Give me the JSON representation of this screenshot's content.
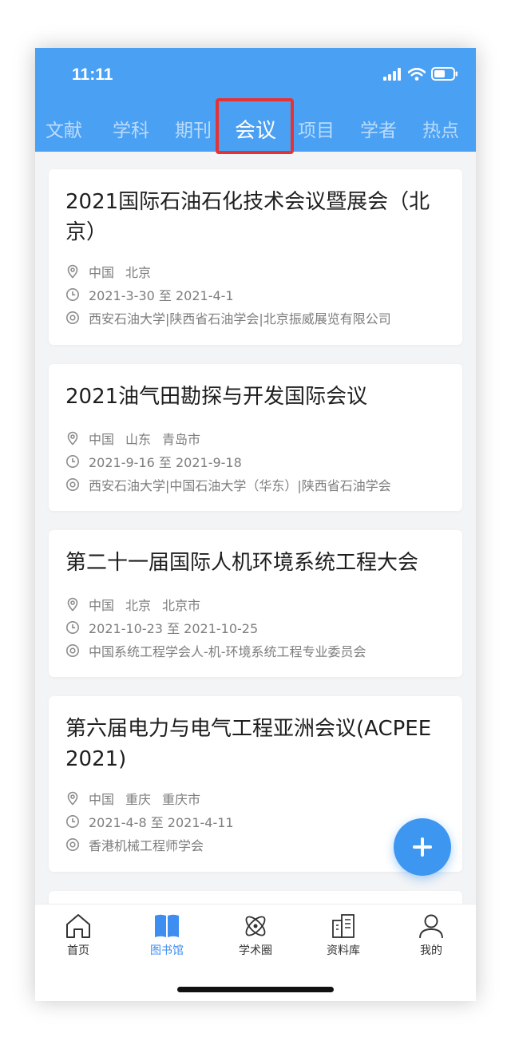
{
  "status_bar": {
    "time": "11:11"
  },
  "category_tabs": [
    {
      "label": "文献",
      "active": false
    },
    {
      "label": "学科",
      "active": false
    },
    {
      "label": "期刊",
      "active": false
    },
    {
      "label": "会议",
      "active": true
    },
    {
      "label": "项目",
      "active": false
    },
    {
      "label": "学者",
      "active": false
    },
    {
      "label": "热点",
      "active": false
    }
  ],
  "conferences": [
    {
      "title": "2021国际石油石化技术会议暨展会（北京）",
      "location": [
        "中国",
        "北京"
      ],
      "dates": "2021-3-30 至 2021-4-1",
      "organizers": "西安石油大学|陕西省石油学会|北京振威展览有限公司"
    },
    {
      "title": "2021油气田勘探与开发国际会议",
      "location": [
        "中国",
        "山东",
        "青岛市"
      ],
      "dates": "2021-9-16 至 2021-9-18",
      "organizers": "西安石油大学|中国石油大学（华东）|陕西省石油学会"
    },
    {
      "title": "第二十一届国际人机环境系统工程大会",
      "location": [
        "中国",
        "北京",
        "北京市"
      ],
      "dates": "2021-10-23 至 2021-10-25",
      "organizers": "中国系统工程学会人-机-环境系统工程专业委员会"
    },
    {
      "title": "第六届电力与电气工程亚洲会议(ACPEE 2021)",
      "location": [
        "中国",
        "重庆",
        "重庆市"
      ],
      "dates": "2021-4-8 至 2021-4-11",
      "organizers": "香港机械工程师学会"
    }
  ],
  "bottom_nav": [
    {
      "label": "首页",
      "icon": "home-icon",
      "active": false
    },
    {
      "label": "图书馆",
      "icon": "book-icon",
      "active": true
    },
    {
      "label": "学术圈",
      "icon": "atom-icon",
      "active": false
    },
    {
      "label": "资料库",
      "icon": "buildings-icon",
      "active": false
    },
    {
      "label": "我的",
      "icon": "user-icon",
      "active": false
    }
  ],
  "colors": {
    "header_blue": "#4aa0f3",
    "fab_blue": "#3d96f0",
    "active_nav": "#3d8ef0",
    "tab_highlight_red": "#e63232"
  }
}
